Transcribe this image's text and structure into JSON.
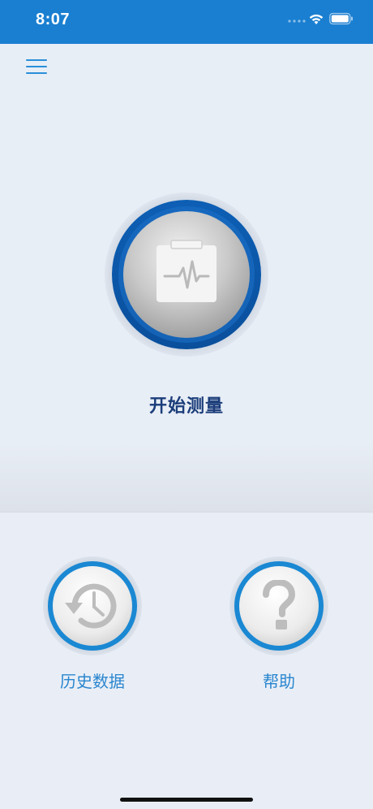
{
  "status_bar": {
    "time": "8:07",
    "background_color": "#1a7fd1",
    "icons": [
      "signal-dots-icon",
      "wifi-icon",
      "battery-icon"
    ]
  },
  "menu": {
    "icon": "hamburger-menu-icon",
    "accent_color": "#2a8fd9"
  },
  "measure": {
    "label": "开始测量",
    "icon": "clipboard-heartbeat-icon",
    "ring_color": "#0d5fb5",
    "label_color": "#1b3d7a"
  },
  "history": {
    "label": "历史数据",
    "icon": "clock-history-icon"
  },
  "help": {
    "label": "帮助",
    "icon": "question-mark-icon"
  },
  "colors": {
    "background": "#e9eef6",
    "secondary_label": "#2a86cf",
    "secondary_ring": "#1a88d3"
  }
}
